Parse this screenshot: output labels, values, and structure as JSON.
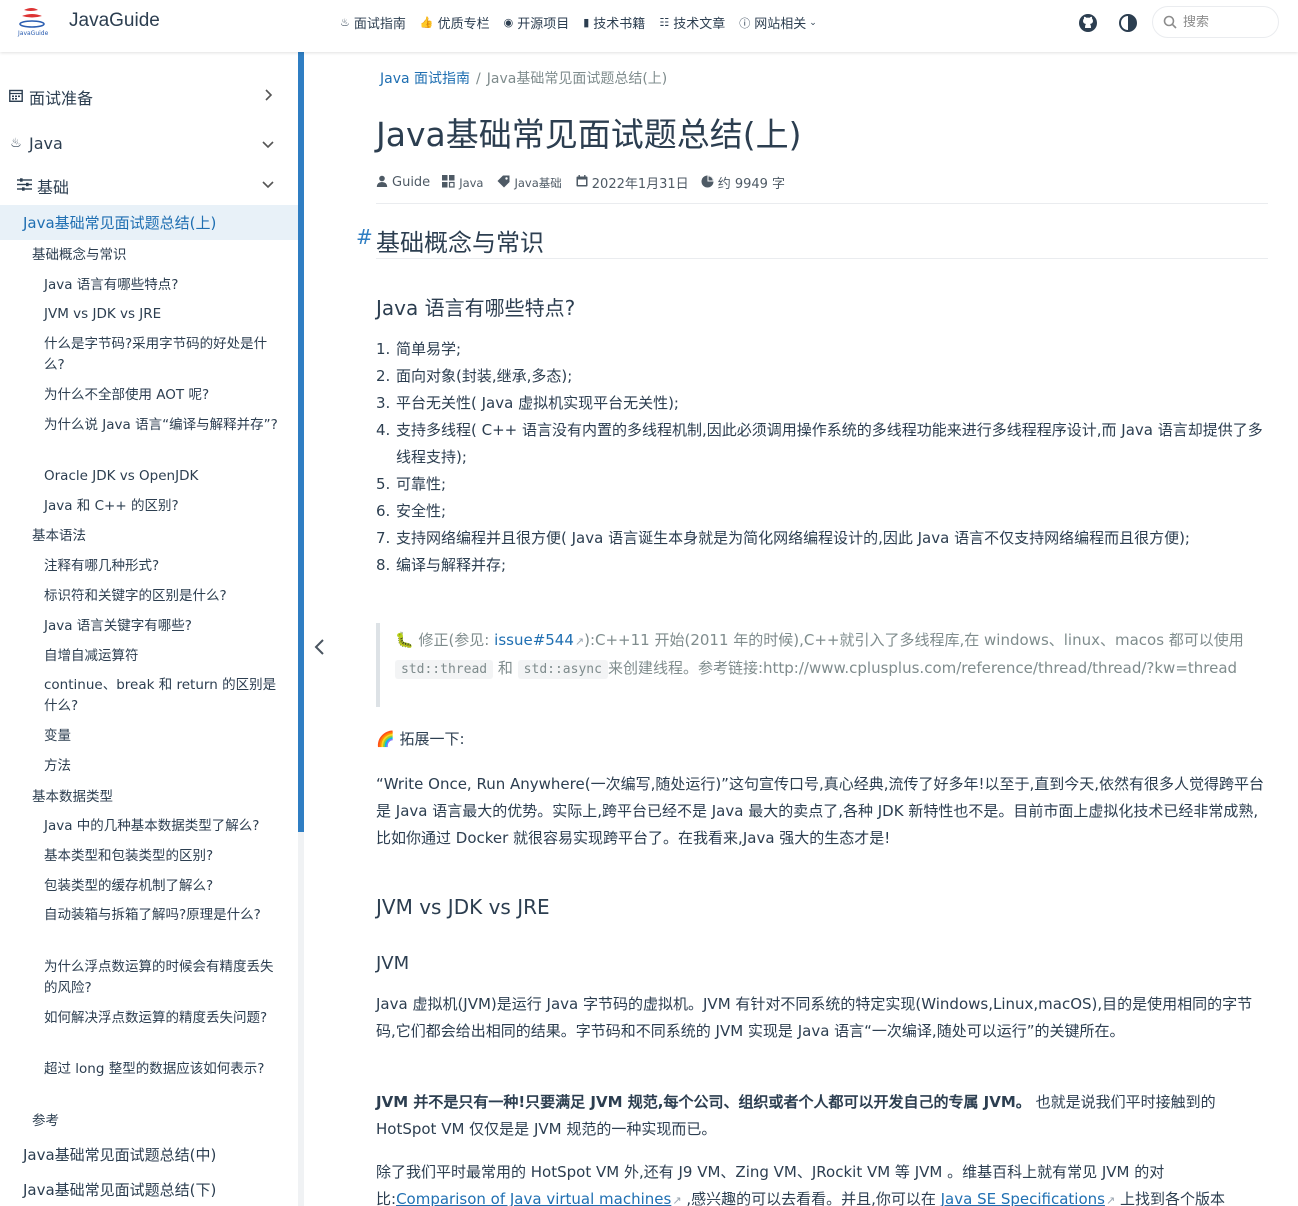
{
  "navbar": {
    "brand": "JavaGuide",
    "links": [
      {
        "icon": "book-icon",
        "glyph": "♨",
        "label": "面试指南"
      },
      {
        "icon": "thumbs-up-icon",
        "glyph": "👍",
        "label": "优质专栏"
      },
      {
        "icon": "github-icon",
        "glyph": "◉",
        "label": "开源项目"
      },
      {
        "icon": "book-icon",
        "glyph": "▮",
        "label": "技术书籍"
      },
      {
        "icon": "article-icon",
        "glyph": "☷",
        "label": "技术文章"
      },
      {
        "icon": "info-icon",
        "glyph": "ⓘ",
        "label": "网站相关",
        "dropdown": true
      }
    ],
    "search_placeholder": "搜索"
  },
  "sidebar": {
    "groups": [
      {
        "label": "面试准备",
        "icon": "calendar-icon",
        "expanded": false
      },
      {
        "label": "Java",
        "icon": "java-icon",
        "expanded": true
      },
      {
        "label": "基础",
        "icon": "sliders-icon",
        "expanded": true
      }
    ],
    "active_page": "Java基础常见面试题总结(上)",
    "toc": [
      {
        "level": 1,
        "label": "基础概念与常识"
      },
      {
        "level": 2,
        "label": "Java 语言有哪些特点?"
      },
      {
        "level": 2,
        "label": "JVM vs JDK vs JRE"
      },
      {
        "level": 2,
        "label": "什么是字节码?采用字节码的好处是什么?"
      },
      {
        "level": 2,
        "label": "为什么不全部使用 AOT 呢?"
      },
      {
        "level": 2,
        "label": "为什么说 Java 语言“编译与解释并存”?"
      },
      {
        "level": 2,
        "label": "Oracle JDK vs OpenJDK"
      },
      {
        "level": 2,
        "label": "Java 和 C++ 的区别?"
      },
      {
        "level": 1,
        "label": "基本语法"
      },
      {
        "level": 2,
        "label": "注释有哪几种形式?"
      },
      {
        "level": 2,
        "label": "标识符和关键字的区别是什么?"
      },
      {
        "level": 2,
        "label": "Java 语言关键字有哪些?"
      },
      {
        "level": 2,
        "label": "自增自减运算符"
      },
      {
        "level": 2,
        "label": "continue、break 和 return 的区别是什么?"
      },
      {
        "level": 2,
        "label": "变量"
      },
      {
        "level": 2,
        "label": "方法"
      },
      {
        "level": 1,
        "label": "基本数据类型"
      },
      {
        "level": 2,
        "label": "Java 中的几种基本数据类型了解么?"
      },
      {
        "level": 2,
        "label": "基本类型和包装类型的区别?"
      },
      {
        "level": 2,
        "label": "包装类型的缓存机制了解么?"
      },
      {
        "level": 2,
        "label": "自动装箱与拆箱了解吗?原理是什么?"
      },
      {
        "level": 2,
        "label": "为什么浮点数运算的时候会有精度丢失的风险?"
      },
      {
        "level": 2,
        "label": "如何解决浮点数运算的精度丢失问题?"
      },
      {
        "level": 2,
        "label": "超过 long 整型的数据应该如何表示?"
      },
      {
        "level": 1,
        "label": "参考"
      }
    ],
    "next_pages": [
      "Java基础常见面试题总结(中)",
      "Java基础常见面试题总结(下)"
    ]
  },
  "content": {
    "breadcrumb": [
      "Java 面试指南",
      "Java基础常见面试题总结(上)"
    ],
    "title": "Java基础常见面试题总结(上)",
    "meta": {
      "author": "Guide",
      "category": "Java",
      "tag": "Java基础",
      "date": "2022年1月31日",
      "word_count": "约 9949 字"
    },
    "h2_anchor": "#",
    "h2": "基础概念与常识",
    "h3_features": "Java 语言有哪些特点?",
    "features": [
      "简单易学;",
      "面向对象(封装,继承,多态);",
      "平台无关性( Java 虚拟机实现平台无关性);",
      "支持多线程( C++ 语言没有内置的多线程机制,因此必须调用操作系统的多线程功能来进行多线程程序设计,而 Java 语言却提供了多线程支持);",
      "可靠性;",
      "安全性;",
      "支持网络编程并且很方便( Java 语言诞生本身就是为简化网络编程设计的,因此 Java 语言不仅支持网络编程而且很方便);",
      "编译与解释并存;"
    ],
    "quote": {
      "emoji": "🐛",
      "prefix": " 修正(参见:",
      "link": "issue#544",
      "mid": "):C++11 开始(2011 年的时候),C++就引入了多线程库,在 windows、linux、macos 都可以使用",
      "code1": "std::thread",
      "and": "和",
      "code2": "std::async",
      "suffix": "来创建线程。参考链接:http://www.cplusplus.com/reference/thread/thread/?kw=thread"
    },
    "expand_label": "🌈 拓展一下:",
    "expand_para": "“Write Once, Run Anywhere(一次编写,随处运行)”这句宣传口号,真心经典,流传了好多年!以至于,直到今天,依然有很多人觉得跨平台是 Java 语言最大的优势。实际上,跨平台已经不是 Java 最大的卖点了,各种 JDK 新特性也不是。目前市面上虚拟化技术已经非常成熟,比如你通过 Docker 就很容易实现跨平台了。在我看来,Java 强大的生态才是!",
    "h3_jvm": "JVM vs JDK vs JRE",
    "h4_jvm": "JVM",
    "jvm_para1": "Java 虚拟机(JVM)是运行 Java 字节码的虚拟机。JVM 有针对不同系统的特定实现(Windows,Linux,macOS),目的是使用相同的字节码,它们都会给出相同的结果。字节码和不同系统的 JVM 实现是 Java 语言“一次编译,随处可以运行”的关键所在。",
    "jvm_para2_bold": "JVM 并不是只有一种!只要满足 JVM 规范,每个公司、组织或者个人都可以开发自己的专属 JVM。",
    "jvm_para2_rest": " 也就是说我们平时接触到的 HotSpot VM 仅仅是是 JVM 规范的一种实现而已。",
    "jvm_para3_a": "除了我们平时最常用的 HotSpot VM 外,还有 J9 VM、Zing VM、JRockit VM 等 JVM 。维基百科上就有常见 JVM 的对比:",
    "jvm_para3_link1": "Comparison of Java virtual machines",
    "jvm_para3_b": " ,感兴趣的可以去看看。并且,你可以在 ",
    "jvm_para3_link2": "Java SE Specifications",
    "jvm_para3_c": " 上找到各个版本"
  }
}
